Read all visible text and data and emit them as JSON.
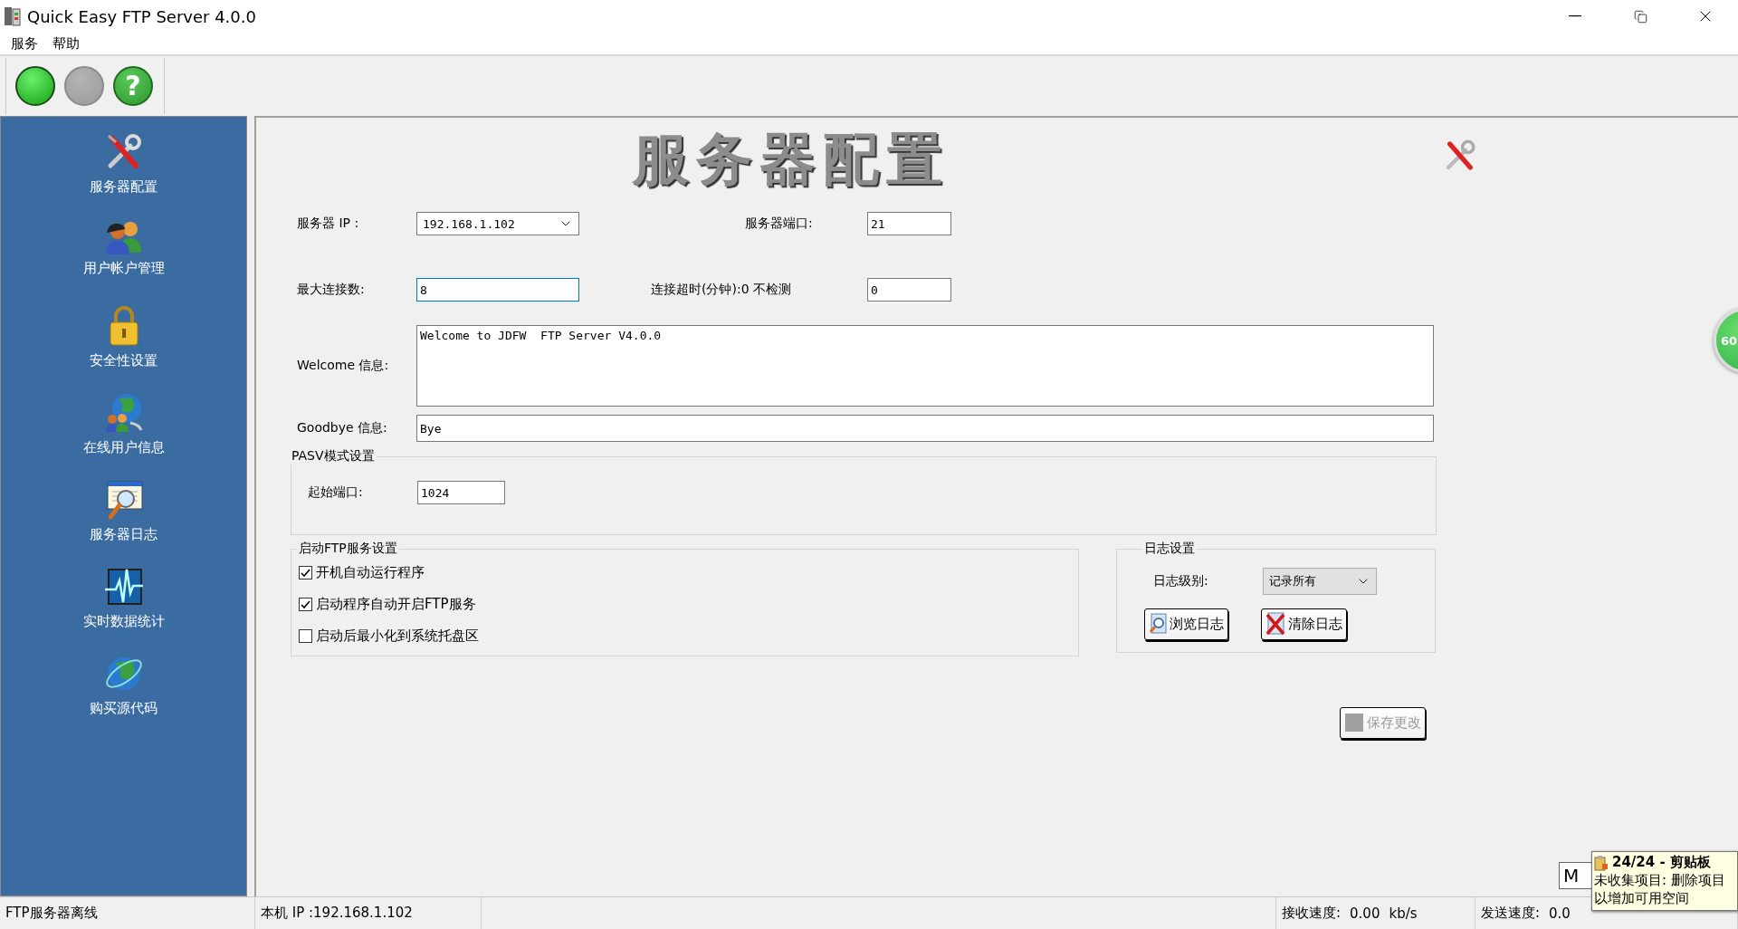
{
  "window": {
    "title": "Quick Easy FTP Server 4.0.0"
  },
  "menu": [
    "服务",
    "帮助"
  ],
  "toolbar": [
    {
      "kind": "start",
      "disabled": false
    },
    {
      "kind": "stop",
      "disabled": true
    },
    {
      "kind": "help",
      "disabled": false,
      "label": "?"
    }
  ],
  "sidebar": {
    "items": [
      {
        "label": "服务器配置",
        "kind": "tools"
      },
      {
        "label": "用户帐户管理",
        "kind": "users"
      },
      {
        "label": "安全性设置",
        "kind": "lock"
      },
      {
        "label": "在线用户信息",
        "kind": "online"
      },
      {
        "label": "服务器日志",
        "kind": "log"
      },
      {
        "label": "实时数据统计",
        "kind": "stats"
      },
      {
        "label": "购买源代码",
        "kind": "globe"
      }
    ]
  },
  "panel": {
    "title": "服务器配置",
    "server_ip": {
      "label": "服务器 IP :",
      "value": "192.168.1.102"
    },
    "server_port": {
      "label": "服务器端口:",
      "value": "21"
    },
    "max_connections": {
      "label": "最大连接数:",
      "value": "8"
    },
    "timeout": {
      "label": "连接超时(分钟):0 不检测",
      "value": "0"
    },
    "welcome": {
      "label": "Welcome 信息:",
      "value": "Welcome to JDFW  FTP Server V4.0.0"
    },
    "goodbye": {
      "label": "Goodbye 信息:",
      "value": "Bye"
    },
    "pasv": {
      "legend": "PASV模式设置",
      "start_port": {
        "label": "起始端口:",
        "value": "1024"
      }
    },
    "startup": {
      "legend": "启动FTP服务设置",
      "options": [
        {
          "label": "开机自动运行程序",
          "checked": true
        },
        {
          "label": "启动程序自动开启FTP服务",
          "checked": true
        },
        {
          "label": "启动后最小化到系统托盘区",
          "checked": false
        }
      ]
    },
    "log": {
      "legend": "日志设置",
      "level": {
        "label": "日志级别:",
        "value": "记录所有"
      },
      "buttons": [
        {
          "label": "浏览日志",
          "kind": "browse"
        },
        {
          "label": "清除日志",
          "kind": "clear"
        }
      ]
    },
    "save_button": {
      "label": "保存更改",
      "disabled": true
    }
  },
  "status_bar": {
    "server_state": "FTP服务器离线",
    "local_ip": "本机 IP :192.168.1.102",
    "receive": {
      "label": "接收速度:",
      "value": "0.00",
      "unit": "kb/s"
    },
    "send": {
      "label": "发送速度:",
      "value": "0.0"
    }
  },
  "floating_badge": {
    "text": "60"
  },
  "hidden_button": {
    "label": "M"
  },
  "clipboard_tip": {
    "title": "24/24 - 剪贴板",
    "message": "未收集项目: 删除项目以增加可用空间"
  }
}
